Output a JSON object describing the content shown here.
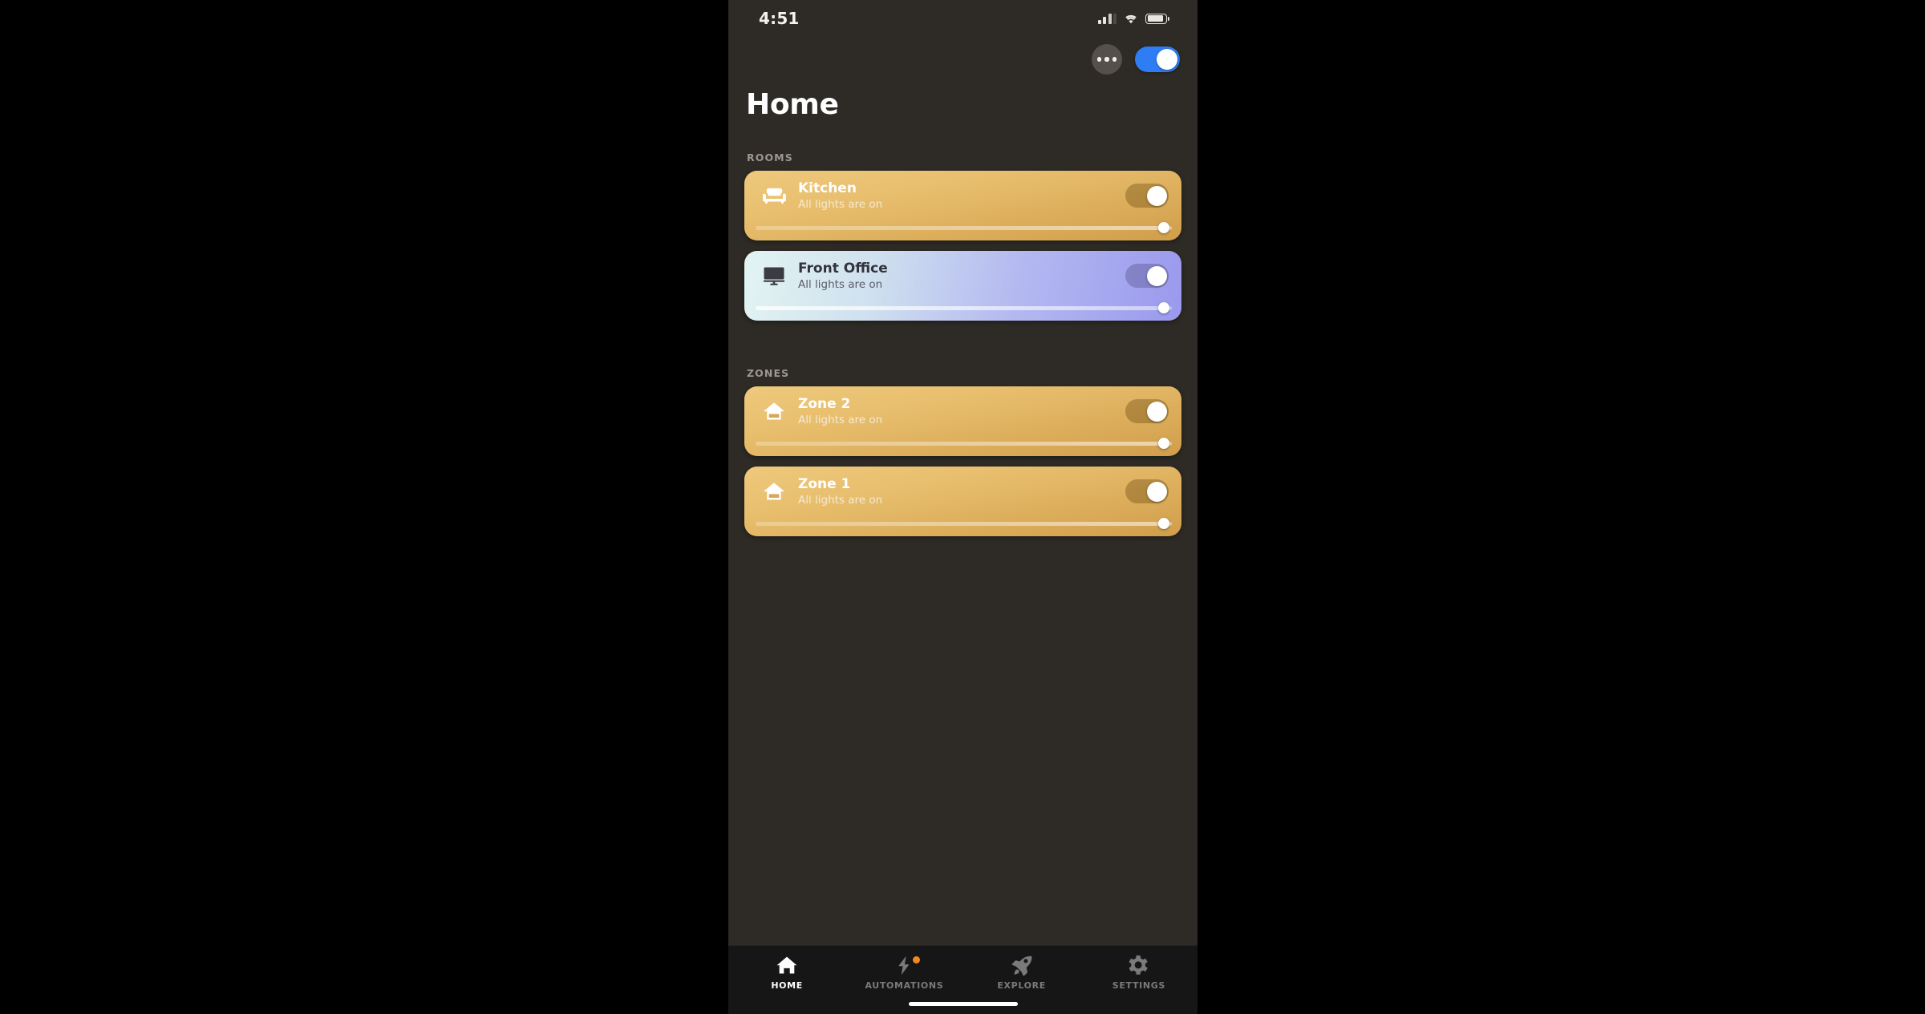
{
  "status_bar": {
    "time": "4:51",
    "icons": [
      "cellular-signal-icon",
      "wifi-icon",
      "battery-icon"
    ]
  },
  "header": {
    "title": "Home",
    "more_button_icon": "more-horizontal-icon",
    "master_toggle_state": "on",
    "master_toggle_color": "#2f7df4"
  },
  "sections": [
    {
      "label": "ROOMS",
      "cards": [
        {
          "name": "Kitchen",
          "status": "All lights are on",
          "icon": "sofa-icon",
          "theme": "amber",
          "toggle_state": "on",
          "brightness_percent": 98
        },
        {
          "name": "Front Office",
          "status": "All lights are on",
          "icon": "monitor-icon",
          "theme": "violet",
          "toggle_state": "on",
          "brightness_percent": 98
        }
      ]
    },
    {
      "label": "ZONES",
      "cards": [
        {
          "name": "Zone 2",
          "status": "All lights are on",
          "icon": "house-zone-icon",
          "theme": "amber",
          "toggle_state": "on",
          "brightness_percent": 98
        },
        {
          "name": "Zone 1",
          "status": "All lights are on",
          "icon": "house-zone-icon",
          "theme": "amber",
          "toggle_state": "on",
          "brightness_percent": 98
        }
      ]
    }
  ],
  "tab_bar": {
    "tabs": [
      {
        "label": "HOME",
        "icon": "home-icon",
        "active": true,
        "badge": false
      },
      {
        "label": "AUTOMATIONS",
        "icon": "lightning-bolt-icon",
        "active": false,
        "badge": true,
        "badge_color": "#f08a1e"
      },
      {
        "label": "EXPLORE",
        "icon": "rocket-icon",
        "active": false,
        "badge": false
      },
      {
        "label": "SETTINGS",
        "icon": "gear-icon",
        "active": false,
        "badge": false
      }
    ]
  },
  "colors": {
    "screen_background": "#2e2a25",
    "amber_card": "#e8bf6e",
    "violet_card": "#9a99ee",
    "accent_blue": "#2f7df4",
    "badge_orange": "#f08a1e"
  }
}
